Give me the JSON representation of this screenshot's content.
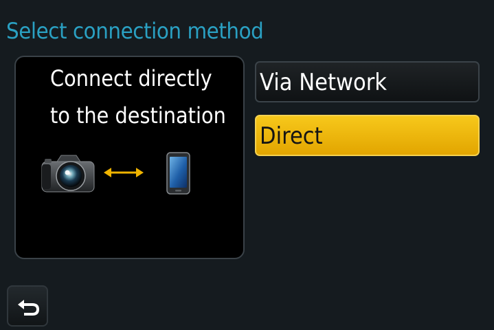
{
  "header": {
    "title": "Select connection method"
  },
  "info_panel": {
    "line1": "Connect directly",
    "line2": "to the destination",
    "icons": [
      "camera-icon",
      "double-arrow-icon",
      "smartphone-icon"
    ]
  },
  "options": [
    {
      "label": "Via Network",
      "selected": false
    },
    {
      "label": "Direct",
      "selected": true
    }
  ],
  "footer": {
    "back_icon": "return-arrow-icon"
  },
  "colors": {
    "title": "#2aa0c2",
    "selected_option": "#f2b800",
    "arrow": "#f0b400",
    "background": "#151b1f"
  }
}
